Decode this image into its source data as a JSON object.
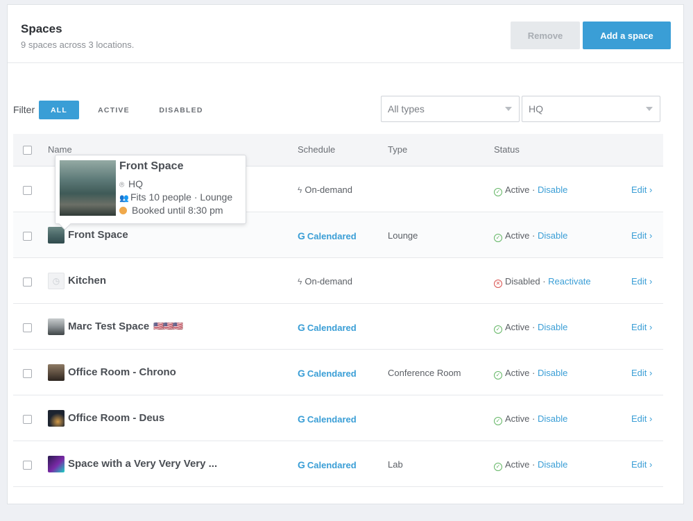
{
  "header": {
    "title": "Spaces",
    "subtitle": "9 spaces across 3 locations.",
    "remove_label": "Remove",
    "add_label": "Add a space"
  },
  "filter": {
    "label": "Filter",
    "tabs": [
      "ALL",
      "ACTIVE",
      "DISABLED"
    ],
    "types_value": "All types",
    "location_value": "HQ"
  },
  "table": {
    "columns": {
      "name": "Name",
      "schedule": "Schedule",
      "type": "Type",
      "status": "Status"
    },
    "rows": [
      {
        "name": "",
        "schedule": "On-demand",
        "type": "",
        "status": "Active",
        "action": "Disable",
        "edit": "Edit ›"
      },
      {
        "name": "Front Space",
        "schedule": "Calendared",
        "type": "Lounge",
        "status": "Active",
        "action": "Disable",
        "edit": "Edit ›"
      },
      {
        "name": "Kitchen",
        "schedule": "On-demand",
        "type": "",
        "status": "Disabled",
        "action": "Reactivate",
        "edit": "Edit ›"
      },
      {
        "name": "Marc Test Space",
        "flags": "🇺🇸🇺🇸🇺🇸",
        "schedule": "Calendared",
        "type": "",
        "status": "Active",
        "action": "Disable",
        "edit": "Edit ›"
      },
      {
        "name": "Office Room - Chrono",
        "schedule": "Calendared",
        "type": "Conference Room",
        "status": "Active",
        "action": "Disable",
        "edit": "Edit ›"
      },
      {
        "name": "Office Room - Deus",
        "schedule": "Calendared",
        "type": "",
        "status": "Active",
        "action": "Disable",
        "edit": "Edit ›"
      },
      {
        "name": "Space with a Very Very Very ...",
        "schedule": "Calendared",
        "type": "Lab",
        "status": "Active",
        "action": "Disable",
        "edit": "Edit ›"
      }
    ]
  },
  "popover": {
    "title": "Front Space",
    "location": "HQ",
    "fits": "Fits 10 people · Lounge",
    "booked": "Booked until 8:30 pm"
  },
  "icons": {
    "schedule_calendared": "G",
    "schedule_ondemand": "bolt",
    "status_active": "check-circle",
    "status_disabled": "x-circle"
  },
  "colors": {
    "accent": "#3a9ed6",
    "active": "#63b665",
    "disabled": "#d9534f",
    "booked": "#f0a94b"
  }
}
